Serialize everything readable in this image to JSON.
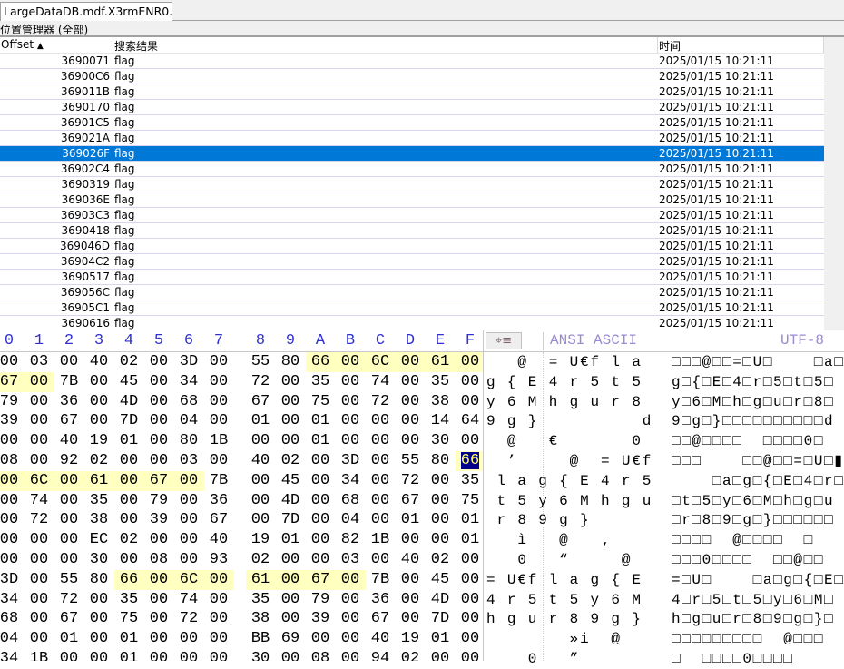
{
  "tab": {
    "title": "LargeDataDB.mdf.X3rmENR0..."
  },
  "panel": {
    "title": "位置管理器 (全部)"
  },
  "list": {
    "headers": {
      "offset": "Offset",
      "result": "搜索结果",
      "time": "时间"
    },
    "sort_icon": "triangle-up-icon",
    "selected_index": 6,
    "rows": [
      {
        "offset": "3690071",
        "result": "flag",
        "time": "2025/01/15  10:21:11"
      },
      {
        "offset": "36900C6",
        "result": "flag",
        "time": "2025/01/15  10:21:11"
      },
      {
        "offset": "369011B",
        "result": "flag",
        "time": "2025/01/15  10:21:11"
      },
      {
        "offset": "3690170",
        "result": "flag",
        "time": "2025/01/15  10:21:11"
      },
      {
        "offset": "36901C5",
        "result": "flag",
        "time": "2025/01/15  10:21:11"
      },
      {
        "offset": "369021A",
        "result": "flag",
        "time": "2025/01/15  10:21:11"
      },
      {
        "offset": "369026F",
        "result": "flag",
        "time": "2025/01/15  10:21:11"
      },
      {
        "offset": "36902C4",
        "result": "flag",
        "time": "2025/01/15  10:21:11"
      },
      {
        "offset": "3690319",
        "result": "flag",
        "time": "2025/01/15  10:21:11"
      },
      {
        "offset": "369036E",
        "result": "flag",
        "time": "2025/01/15  10:21:11"
      },
      {
        "offset": "36903C3",
        "result": "flag",
        "time": "2025/01/15  10:21:11"
      },
      {
        "offset": "3690418",
        "result": "flag",
        "time": "2025/01/15  10:21:11"
      },
      {
        "offset": "369046D",
        "result": "flag",
        "time": "2025/01/15  10:21:11"
      },
      {
        "offset": "36904C2",
        "result": "flag",
        "time": "2025/01/15  10:21:11"
      },
      {
        "offset": "3690517",
        "result": "flag",
        "time": "2025/01/15  10:21:11"
      },
      {
        "offset": "369056C",
        "result": "flag",
        "time": "2025/01/15  10:21:11"
      },
      {
        "offset": "36905C1",
        "result": "flag",
        "time": "2025/01/15  10:21:11"
      },
      {
        "offset": "3690616",
        "result": "flag",
        "time": "2025/01/15  10:21:11"
      }
    ]
  },
  "hex": {
    "columns": [
      "0",
      "1",
      "2",
      "3",
      "4",
      "5",
      "6",
      "7",
      "8",
      "9",
      "A",
      "B",
      "C",
      "D",
      "E",
      "F"
    ],
    "ansi_label": "ANSI ASCII",
    "utf_label": "UTF-8",
    "cursor": {
      "row": 5,
      "col": 15
    },
    "rows": [
      {
        "b": "00 03 00 40 02 00 3D 00 55 80 66 00 6C 00 61 00",
        "hl": [
          10,
          11,
          12,
          13,
          14,
          15
        ],
        "a": "   @  = U€f l a ",
        "u": "□□□@□□=□U□    □a□"
      },
      {
        "b": "67 00 7B 00 45 00 34 00 72 00 35 00 74 00 35 00",
        "hl": [
          0,
          1
        ],
        "a": "g { E 4 r 5 t 5 ",
        "u": "g□{□E□4□r□5□t□5□"
      },
      {
        "b": "79 00 36 00 4D 00 68 00 67 00 75 00 72 00 38 00",
        "hl": [],
        "a": "y 6 M h g u r 8 ",
        "u": "y□6□M□h□g□u□r□8□"
      },
      {
        "b": "39 00 67 00 7D 00 04 00 01 00 01 00 00 00 14 64",
        "hl": [],
        "a": "9 g }          d",
        "u": "9□g□}□□□□□□□□□□d"
      },
      {
        "b": "00 00 40 19 01 00 80 1B 00 00 01 00 00 00 30 00",
        "hl": [],
        "a": "  @   €       0 ",
        "u": "□□@□□□□  □□□□0□"
      },
      {
        "b": "08 00 92 02 00 00 03 00 40 02 00 3D 00 55 80 66",
        "hl": [
          15
        ],
        "a": "  ’     @  = U€f",
        "u": "□□□    □□@□□=□U□▮"
      },
      {
        "b": "00 6C 00 61 00 67 00 7B 00 45 00 34 00 72 00 35",
        "hl": [
          0,
          1,
          2,
          3,
          4,
          5,
          6
        ],
        "a": " l a g { E 4 r 5",
        "u": "    □a□g□{□E□4□r□5"
      },
      {
        "b": "00 74 00 35 00 79 00 36 00 4D 00 68 00 67 00 75",
        "hl": [],
        "a": " t 5 y 6 M h g u",
        "u": "□t□5□y□6□M□h□g□u"
      },
      {
        "b": "00 72 00 38 00 39 00 67 00 7D 00 04 00 01 00 01",
        "hl": [],
        "a": " r 8 9 g }      ",
        "u": "□r□8□9□g□}□□□□□□"
      },
      {
        "b": "00 00 00 EC 02 00 00 40 19 01 00 82 1B 00 00 01",
        "hl": [],
        "a": "   ì   @   ‚    ",
        "u": "□□□□  @□□□□  □"
      },
      {
        "b": "00 00 00 30 00 08 00 93 02 00 00 03 00 40 02 00",
        "hl": [],
        "a": "   0   “     @  ",
        "u": "□□□0□□□□  □□@□□"
      },
      {
        "b": "3D 00 55 80 66 00 6C 00 61 00 67 00 7B 00 45 00",
        "hl": [
          4,
          5,
          6,
          7,
          8,
          9,
          10,
          11
        ],
        "a": "= U€f l a g { E ",
        "u": "=□U□    □a□g□{□E□"
      },
      {
        "b": "34 00 72 00 35 00 74 00 35 00 79 00 36 00 4D 00",
        "hl": [],
        "a": "4 r 5 t 5 y 6 M ",
        "u": "4□r□5□t□5□y□6□M□"
      },
      {
        "b": "68 00 67 00 75 00 72 00 38 00 39 00 67 00 7D 00",
        "hl": [],
        "a": "h g u r 8 9 g } ",
        "u": "h□g□u□r□8□9□g□}□"
      },
      {
        "b": "04 00 01 00 01 00 00 00 BB 69 00 00 40 19 01 00",
        "hl": [],
        "a": "        »i  @   ",
        "u": "□□□□□□□□□  @□□□"
      },
      {
        "b": "34 1B 00 00 01 00 00 00 30 00 08 00 94 02 00 00",
        "hl": [],
        "a": "    0   ”       ",
        "u": "□  □□□□0□□□□"
      }
    ]
  }
}
